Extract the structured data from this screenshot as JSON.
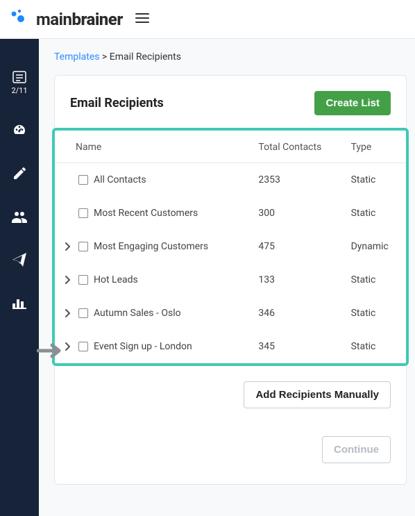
{
  "header": {
    "logo_text_light": "main",
    "logo_text_bold": "brainer"
  },
  "sidebar": {
    "step_counter": "2/11"
  },
  "breadcrumb": {
    "link": "Templates",
    "separator": ">",
    "current": "Email Recipients"
  },
  "card": {
    "title": "Email Recipients",
    "create_btn": "Create List",
    "add_manual_btn": "Add Recipients Manually",
    "continue_btn": "Continue"
  },
  "table": {
    "headers": {
      "name": "Name",
      "total": "Total Contacts",
      "type": "Type"
    },
    "rows": [
      {
        "expandable": false,
        "name": "All Contacts",
        "total": "2353",
        "type": "Static"
      },
      {
        "expandable": false,
        "name": "Most Recent Customers",
        "total": "300",
        "type": "Static"
      },
      {
        "expandable": true,
        "name": "Most Engaging Customers",
        "total": "475",
        "type": "Dynamic"
      },
      {
        "expandable": true,
        "name": "Hot Leads",
        "total": "133",
        "type": "Static"
      },
      {
        "expandable": true,
        "name": "Autumn Sales - Oslo",
        "total": "346",
        "type": "Static"
      },
      {
        "expandable": true,
        "name": "Event Sign up - London",
        "total": "345",
        "type": "Static"
      }
    ]
  }
}
